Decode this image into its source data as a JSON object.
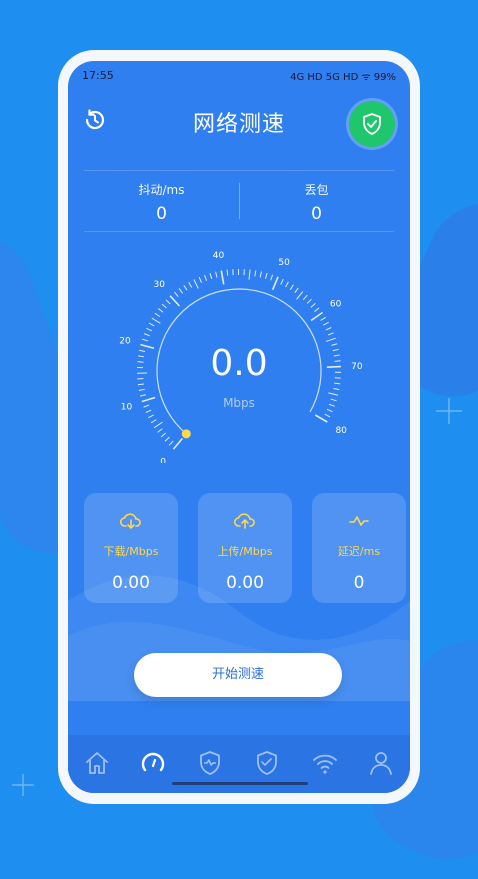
{
  "status": {
    "time": "17:55",
    "indicators": "4G HD 5G HD ᯤ 99%"
  },
  "header": {
    "title": "网络测速",
    "history_icon": "history-icon",
    "shield_icon": "shield-check-icon"
  },
  "stats": [
    {
      "label": "抖动/ms",
      "value": "0"
    },
    {
      "label": "丢包",
      "value": "0"
    }
  ],
  "gauge": {
    "value": "0.0",
    "unit": "Mbps",
    "ticks": [
      "0",
      "10",
      "20",
      "30",
      "40",
      "50",
      "60",
      "70",
      "80"
    ],
    "current": 0
  },
  "cards": [
    {
      "label": "下载/Mbps",
      "value": "0.00",
      "icon": "cloud-download-icon"
    },
    {
      "label": "上传/Mbps",
      "value": "0.00",
      "icon": "cloud-upload-icon"
    },
    {
      "label": "延迟/ms",
      "value": "0",
      "icon": "pulse-icon"
    }
  ],
  "start_button": {
    "label": "开始测速"
  },
  "tabbar": [
    "home-icon",
    "speedometer-icon",
    "shield-pulse-icon",
    "shield-heart-icon",
    "wifi-icon",
    "user-icon"
  ],
  "colors": {
    "screen": "#2f7ff0",
    "accent": "#ffd84a",
    "shield": "#1fc66b",
    "background": "#1e8ff0"
  }
}
